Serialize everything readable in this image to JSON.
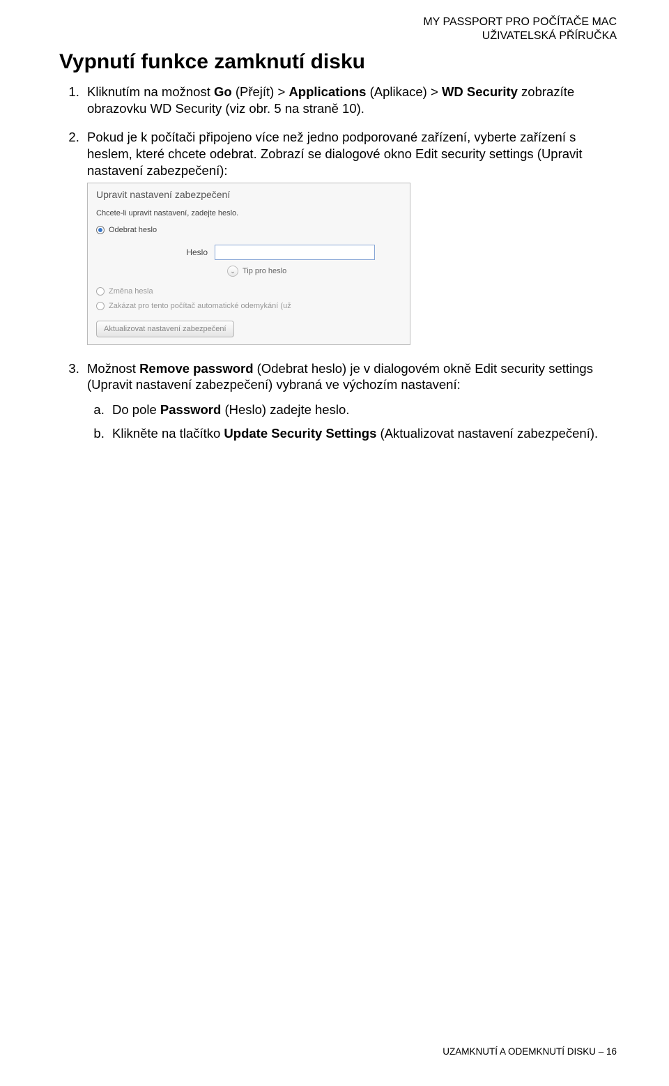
{
  "header": {
    "line1": "MY PASSPORT PRO POČÍTAČE MAC",
    "line2": "UŽIVATELSKÁ PŘÍRUČKA"
  },
  "title": "Vypnutí funkce zamknutí disku",
  "steps": {
    "s1": {
      "pre": "Kliknutím na možnost ",
      "go": "Go",
      "go_paren": " (Přejít) > ",
      "apps": "Applications",
      "apps_paren": " (Aplikace) > ",
      "wd": "WD Security",
      "tail": " zobrazíte obrazovku WD Security (viz obr. 5 na straně 10)."
    },
    "s2": "Pokud je k počítači připojeno více než jedno podporované zařízení, vyberte zařízení s heslem, které chcete odebrat. Zobrazí se dialogové okno Edit security settings (Upravit nastavení zabezpečení):",
    "s3": {
      "pre": "Možnost ",
      "bold": "Remove password",
      "tail": " (Odebrat heslo) je v dialogovém okně Edit security settings (Upravit nastavení zabezpečení) vybraná ve výchozím nastavení:",
      "a": {
        "pre": "Do pole ",
        "bold": "Password",
        "tail": " (Heslo) zadejte heslo."
      },
      "b": {
        "pre": "Klikněte na tlačítko ",
        "bold": "Update Security Settings",
        "tail": " (Aktualizovat nastavení zabezpečení)."
      }
    }
  },
  "dialog": {
    "title": "Upravit nastavení zabezpečení",
    "hint": "Chcete-li upravit nastavení, zadejte heslo.",
    "opt_remove": "Odebrat heslo",
    "field_label": "Heslo",
    "field_value": "",
    "tip": "Tip pro heslo",
    "opt_change": "Změna hesla",
    "opt_disable": "Zakázat pro tento počítač automatické odemykání (už",
    "button": "Aktualizovat nastavení zabezpečení"
  },
  "footer": "UZAMKNUTÍ A ODEMKNUTÍ DISKU – 16"
}
